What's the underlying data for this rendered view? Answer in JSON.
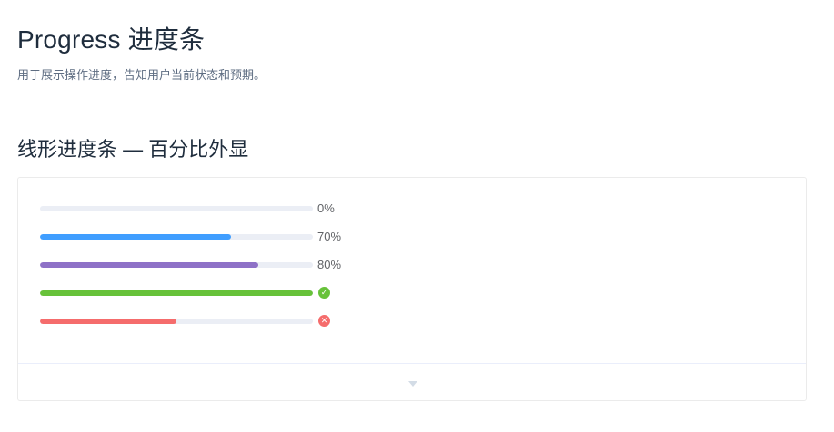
{
  "header": {
    "title": "Progress 进度条",
    "subtitle": "用于展示操作进度，告知用户当前状态和预期。"
  },
  "section": {
    "title": "线形进度条 — 百分比外显"
  },
  "progress_bars": [
    {
      "percentage": 0,
      "label": "0%",
      "color": "#409eff",
      "status": null
    },
    {
      "percentage": 70,
      "label": "70%",
      "color": "#409eff",
      "status": null
    },
    {
      "percentage": 80,
      "label": "80%",
      "color": "#8e71c7",
      "status": null
    },
    {
      "percentage": 100,
      "label": "",
      "color": "#67c23a",
      "status": "success",
      "icon": "check-circle-icon"
    },
    {
      "percentage": 50,
      "label": "",
      "color": "#f56c6c",
      "status": "exception",
      "icon": "close-circle-icon"
    }
  ],
  "demo_meta": {
    "icon": "caret-down-icon"
  }
}
